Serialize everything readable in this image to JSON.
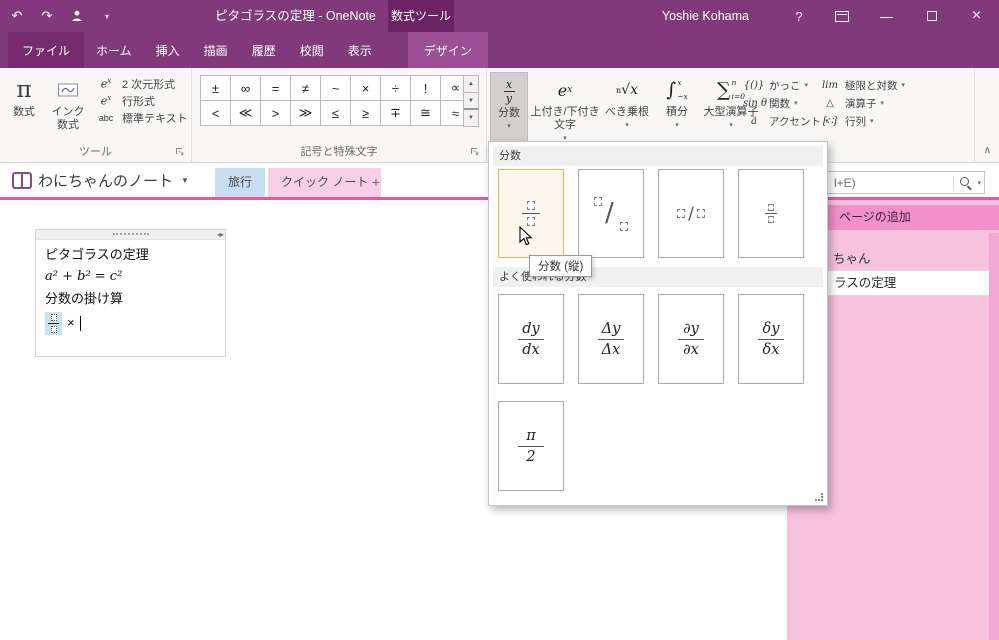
{
  "titlebar": {
    "title": "ピタゴラスの定理 - OneNote",
    "contextual_label": "数式ツール",
    "user_name": "Yoshie Kohama",
    "help": "?"
  },
  "ui": {
    "undo": "↶",
    "redo": "↷",
    "dropdown_arrow": "▾",
    "down_small": "▼",
    "up_small": "▲",
    "minimize": "—",
    "close": "×",
    "collapse_chevron": "∧",
    "resize_arrows": "◂▸",
    "slash": "∕"
  },
  "ribbon": {
    "file_tab": "ファイル",
    "tabs": [
      "ホーム",
      "挿入",
      "描画",
      "履歴",
      "校閲",
      "表示"
    ],
    "active_tab": "デザイン",
    "groups": {
      "tools_label": "ツール",
      "symbols_label": "記号と特殊文字"
    },
    "tools": {
      "pi": "π",
      "equation": "数式",
      "ink_line1": "インク",
      "ink_line2": "数式",
      "e_base": "e",
      "e_sup": "x",
      "professional": "2 次元形式",
      "linear": "行形式",
      "abc": "abc",
      "normal_text": "標準テキスト"
    },
    "symbols": {
      "row1": [
        "±",
        "∞",
        "=",
        "≠",
        "~",
        "×",
        "÷",
        "!",
        "∝"
      ],
      "row2": [
        "<",
        "≪",
        ">",
        "≫",
        "≤",
        "≥",
        "∓",
        "≅",
        "≈"
      ]
    },
    "structures": {
      "fraction_label": "分数",
      "fraction_num": "x",
      "fraction_den": "y",
      "script_label1": "上付き/下付き",
      "script_label2": "文字",
      "radical_label": "べき乗根",
      "radical_index": "n",
      "radical_body": "√x",
      "integral_label": "積分",
      "integral_sign": "∫",
      "integral_sup": "x",
      "integral_sub": "−x",
      "largeop_label": "大型演算子",
      "largeop_sign": "∑",
      "largeop_sup": "n",
      "largeop_sub": "i=0",
      "bracket_icon": "{()}",
      "bracket_label": "かっこ",
      "function_icon": "sin θ",
      "function_label": "関数",
      "accent_icon": "ä",
      "accent_label": "アクセント",
      "limit_icon": "lim",
      "limit_label": "極限と対数",
      "operator_icon": "△",
      "operator_label": "演算子",
      "matrix_icon": "[∷]",
      "matrix_label": "行列"
    }
  },
  "notebook": {
    "name": "わにちゃんのノート",
    "section1": "旅行",
    "section2": "クイック ノート",
    "add_section": "+"
  },
  "search": {
    "fragment": "l+E)"
  },
  "page": {
    "line1": "ピタゴラスの定理",
    "line2": "a² + b² = c²",
    "line3": "分数の掛け算",
    "times": "×"
  },
  "gallery": {
    "header1": "分数",
    "tooltip": "分数 (縦)",
    "header2": "よく使われる分数",
    "fractions": [
      {
        "num": "dy",
        "den": "dx"
      },
      {
        "num": "Δy",
        "den": "Δx"
      },
      {
        "num": "∂y",
        "den": "∂x"
      },
      {
        "num": "δy",
        "den": "δx"
      },
      {
        "num": "π",
        "den": "2"
      }
    ]
  },
  "sidebar": {
    "add_page": "ページの追加",
    "notebook_fragment": "ちゃん",
    "page_fragment": "ラスの定理"
  },
  "colors": {
    "titlebar_purple": "#80397B",
    "accent_pink": "#E558A2",
    "sidebar_pink": "#F6C2DE"
  }
}
